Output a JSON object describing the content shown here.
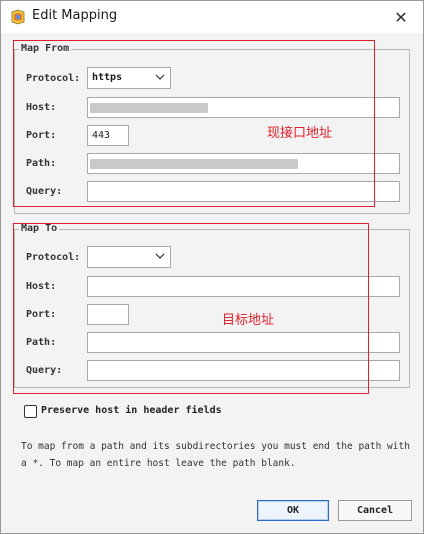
{
  "window": {
    "title": "Edit Mapping",
    "close_glyph": "✕"
  },
  "map_from": {
    "legend": "Map From",
    "labels": {
      "protocol": "Protocol:",
      "host": "Host:",
      "port": "Port:",
      "path": "Path:",
      "query": "Query:"
    },
    "protocol_value": "https",
    "host_value": "",
    "port_value": "443",
    "path_value": "",
    "query_value": ""
  },
  "map_to": {
    "legend": "Map To",
    "labels": {
      "protocol": "Protocol:",
      "host": "Host:",
      "port": "Port:",
      "path": "Path:",
      "query": "Query:"
    },
    "protocol_value": "",
    "host_value": "",
    "port_value": "",
    "path_value": "",
    "query_value": ""
  },
  "annotations": {
    "from_note": "现接口地址",
    "to_note": "目标地址",
    "color": "#e0202c"
  },
  "preserve_host": {
    "label": "Preserve host in header fields",
    "checked": false
  },
  "help_text": "To map from a path and its subdirectories you must end the path with a *. To map an entire host leave the path blank.",
  "buttons": {
    "ok": "OK",
    "cancel": "Cancel"
  },
  "icons": {
    "app": "proxy-app-icon",
    "close": "close-icon",
    "chevron": "chevron-down-icon"
  }
}
